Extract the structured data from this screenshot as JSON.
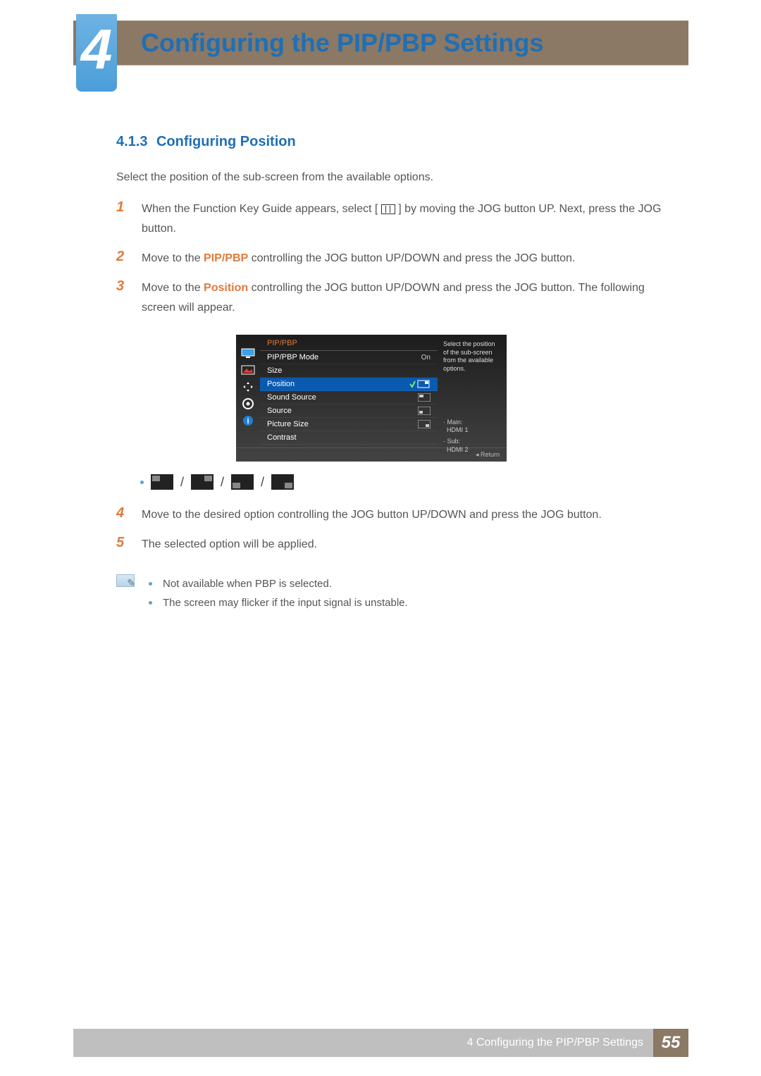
{
  "chapter": {
    "number": "4",
    "title": "Configuring the PIP/PBP Settings"
  },
  "section": {
    "number": "4.1.3",
    "title": "Configuring Position"
  },
  "intro": "Select the position of the sub-screen from the available options.",
  "steps": {
    "s1_a": "When the Function Key Guide appears, select [",
    "s1_b": "] by moving the JOG button UP. Next, press the JOG button.",
    "s2_a": "Move to the ",
    "s2_kw": "PIP/PBP",
    "s2_b": " controlling the JOG button UP/DOWN and press the JOG button.",
    "s3_a": "Move to the ",
    "s3_kw": "Position",
    "s3_b": " controlling the JOG button UP/DOWN and press the JOG button. The following screen will appear.",
    "s4": "Move to the desired option controlling the JOG button UP/DOWN and press the JOG button.",
    "s5": "The selected option will be applied."
  },
  "step_numbers": {
    "n1": "1",
    "n2": "2",
    "n3": "3",
    "n4": "4",
    "n5": "5"
  },
  "osd": {
    "heading": "PIP/PBP",
    "rows": {
      "mode": "PIP/PBP Mode",
      "mode_val": "On",
      "size": "Size",
      "position": "Position",
      "sound": "Sound Source",
      "source": "Source",
      "picsize": "Picture Size",
      "contrast": "Contrast"
    },
    "info": "Select the position of the sub-screen from the available options.",
    "main_lbl": "Main:",
    "main_val": "HDMI 1",
    "sub_lbl": "Sub:",
    "sub_val": "HDMI 2",
    "return": "Return"
  },
  "notes": {
    "n1": "Not available when PBP is selected.",
    "n2": "The screen may flicker if the input signal is unstable."
  },
  "footer": {
    "text": "4 Configuring the PIP/PBP Settings",
    "page": "55"
  }
}
